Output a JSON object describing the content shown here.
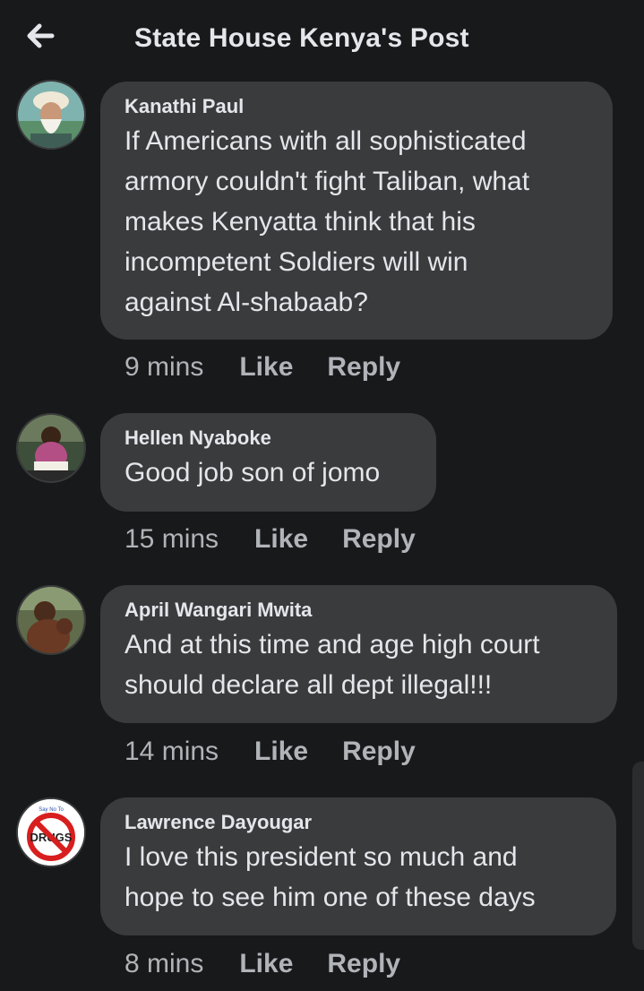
{
  "header": {
    "title": "State House Kenya's Post",
    "back_icon": "arrow-left-icon"
  },
  "colors": {
    "background": "#18191a",
    "bubble": "#3a3b3c",
    "text": "#e4e6eb",
    "muted": "#b0b3b8"
  },
  "comments": [
    {
      "author": "Kanathi Paul",
      "lines": [
        "If Americans with all sophisticated",
        "armory couldn't fight Taliban, what",
        "makes Kenyatta think that his",
        "incompetent Soldiers will win",
        "against Al-shabaab?"
      ],
      "time": "9 mins",
      "like": "Like",
      "reply": "Reply"
    },
    {
      "author": "Hellen Nyaboke",
      "lines": [
        "Good job son of jomo"
      ],
      "time": "15 mins",
      "like": "Like",
      "reply": "Reply"
    },
    {
      "author": "April Wangari Mwita",
      "lines": [
        "And at this time and age high court",
        "should declare all dept illegal!!!"
      ],
      "time": "14 mins",
      "like": "Like",
      "reply": "Reply"
    },
    {
      "author": "Lawrence Dayougar",
      "lines": [
        "I love this president so much and",
        "hope to see him one of these days"
      ],
      "time": "8 mins",
      "like": "Like",
      "reply": "Reply",
      "avatar_text": "DRUGS",
      "avatar_small_text": "Say No To"
    }
  ]
}
